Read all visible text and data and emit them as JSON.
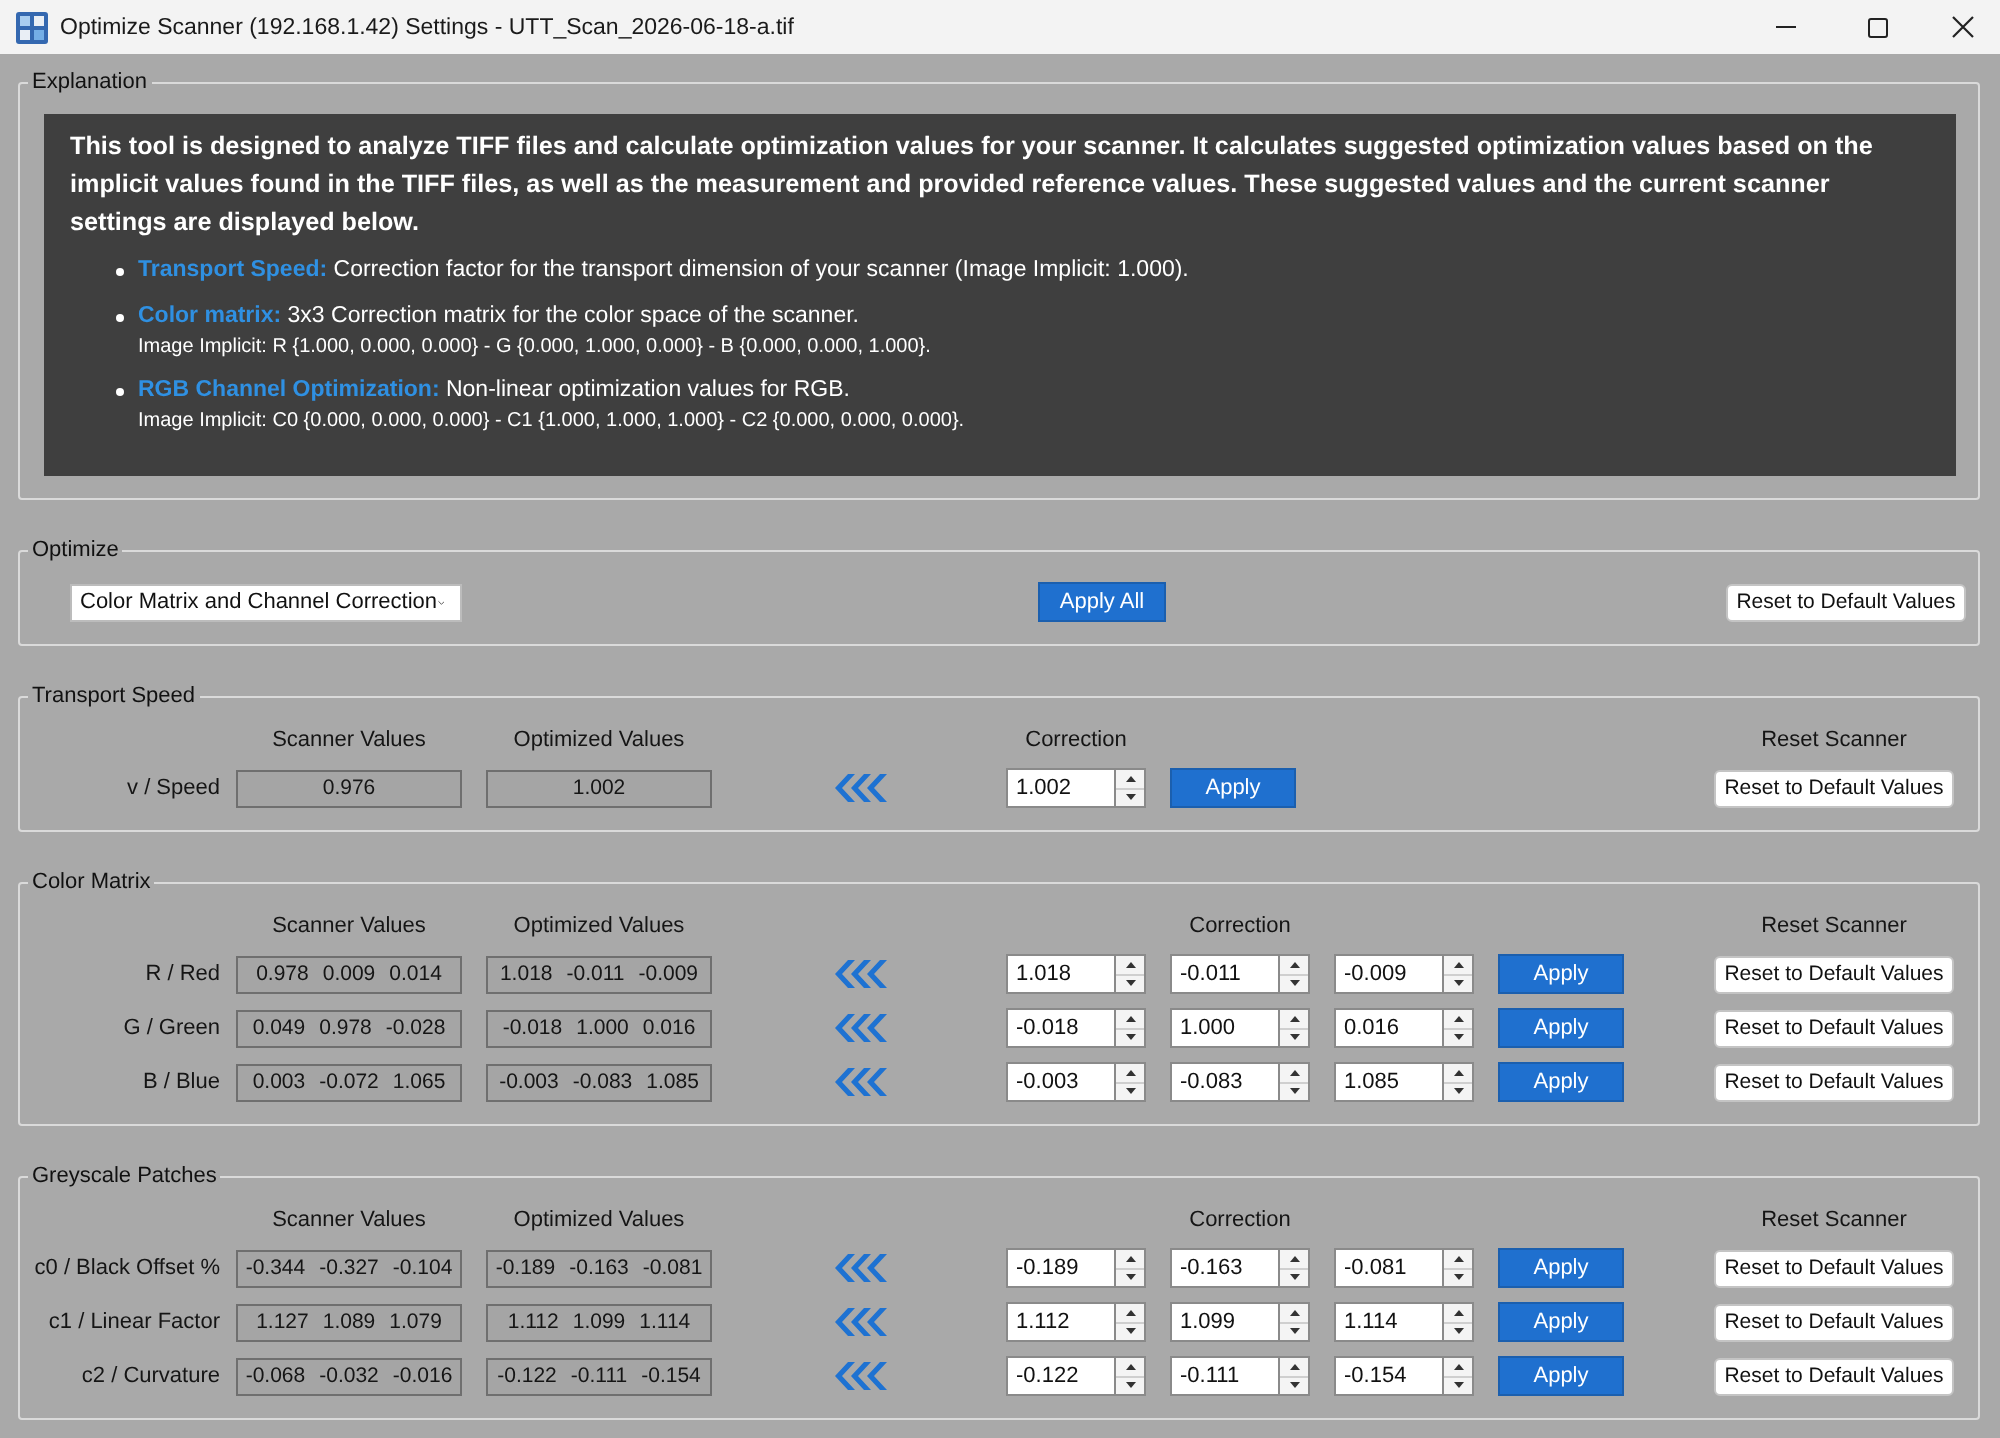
{
  "window": {
    "title": "Optimize Scanner (192.168.1.42) Settings - UTT_Scan_2026-06-18-a.tif"
  },
  "explanation": {
    "title": "Explanation",
    "intro": "This tool is designed to analyze TIFF files and calculate optimization values for your scanner. It calculates suggested optimization values based on the implicit values found in the TIFF files, as well as the measurement and provided reference values. These suggested values and the current scanner settings are displayed below.",
    "items": [
      {
        "text": "**Transport Speed:** Correction factor for the transport dimension of your scanner (Image Implicit: 1.000)."
      },
      {
        "text": "**Color matrix:** 3x3 Correction matrix for the color space of the scanner.",
        "detail": "Image Implicit: R {1.000, 0.000, 0.000} - G {0.000, 1.000, 0.000} - B {0.000, 0.000, 1.000}."
      },
      {
        "text": "**RGB Channel Optimization:** Non-linear optimization values for RGB.",
        "detail": "Image Implicit: C0 {0.000, 0.000, 0.000} - C1 {1.000, 1.000, 1.000} - C2 {0.000, 0.000, 0.000}."
      }
    ]
  },
  "optimize": {
    "title": "Optimize",
    "mode_dropdown": {
      "value": "Color Matrix and Channel Correction"
    },
    "apply_all_button": "Apply All",
    "reset_button": "Reset to Default Values"
  },
  "sections": [
    {
      "title": "Transport Speed",
      "headers": {
        "scanner": "Scanner Values",
        "optimized": "Optimized Values",
        "correction": "Correction",
        "reset": "Reset Scanner"
      },
      "rows": [
        {
          "label": "v / Speed",
          "scanner": [
            "0.976"
          ],
          "optimized": [
            "1.002"
          ],
          "correction": [
            "1.002"
          ],
          "apply": "Apply",
          "reset": "Reset to Default Values"
        }
      ]
    },
    {
      "title": "Color Matrix",
      "headers": {
        "scanner": "Scanner Values",
        "optimized": "Optimized Values",
        "correction": "Correction",
        "reset": "Reset Scanner"
      },
      "rows": [
        {
          "label": "R / Red",
          "scanner": [
            "0.978",
            "0.009",
            "0.014"
          ],
          "optimized": [
            "1.018",
            "-0.011",
            "-0.009"
          ],
          "correction": [
            "1.018",
            "-0.011",
            "-0.009"
          ],
          "apply": "Apply",
          "reset": "Reset to Default Values"
        },
        {
          "label": "G / Green",
          "scanner": [
            "0.049",
            "0.978",
            "-0.028"
          ],
          "optimized": [
            "-0.018",
            "1.000",
            "0.016"
          ],
          "correction": [
            "-0.018",
            "1.000",
            "0.016"
          ],
          "apply": "Apply",
          "reset": "Reset to Default Values"
        },
        {
          "label": "B / Blue",
          "scanner": [
            "0.003",
            "-0.072",
            "1.065"
          ],
          "optimized": [
            "-0.003",
            "-0.083",
            "1.085"
          ],
          "correction": [
            "-0.003",
            "-0.083",
            "1.085"
          ],
          "apply": "Apply",
          "reset": "Reset to Default Values"
        }
      ]
    },
    {
      "title": "Greyscale Patches",
      "headers": {
        "scanner": "Scanner Values",
        "optimized": "Optimized Values",
        "correction": "Correction",
        "reset": "Reset Scanner"
      },
      "rows": [
        {
          "label": "c0 / Black Offset %",
          "scanner": [
            "-0.344",
            "-0.327",
            "-0.104"
          ],
          "optimized": [
            "-0.189",
            "-0.163",
            "-0.081"
          ],
          "correction": [
            "-0.189",
            "-0.163",
            "-0.081"
          ],
          "apply": "Apply",
          "reset": "Reset to Default Values"
        },
        {
          "label": "c1 / Linear Factor",
          "scanner": [
            "1.127",
            "1.089",
            "1.079"
          ],
          "optimized": [
            "1.112",
            "1.099",
            "1.114"
          ],
          "correction": [
            "1.112",
            "1.099",
            "1.114"
          ],
          "apply": "Apply",
          "reset": "Reset to Default Values"
        },
        {
          "label": "c2 / Curvature",
          "scanner": [
            "-0.068",
            "-0.032",
            "-0.016"
          ],
          "optimized": [
            "-0.122",
            "-0.111",
            "-0.154"
          ],
          "correction": [
            "-0.122",
            "-0.111",
            "-0.154"
          ],
          "apply": "Apply",
          "reset": "Reset to Default Values"
        }
      ]
    }
  ]
}
